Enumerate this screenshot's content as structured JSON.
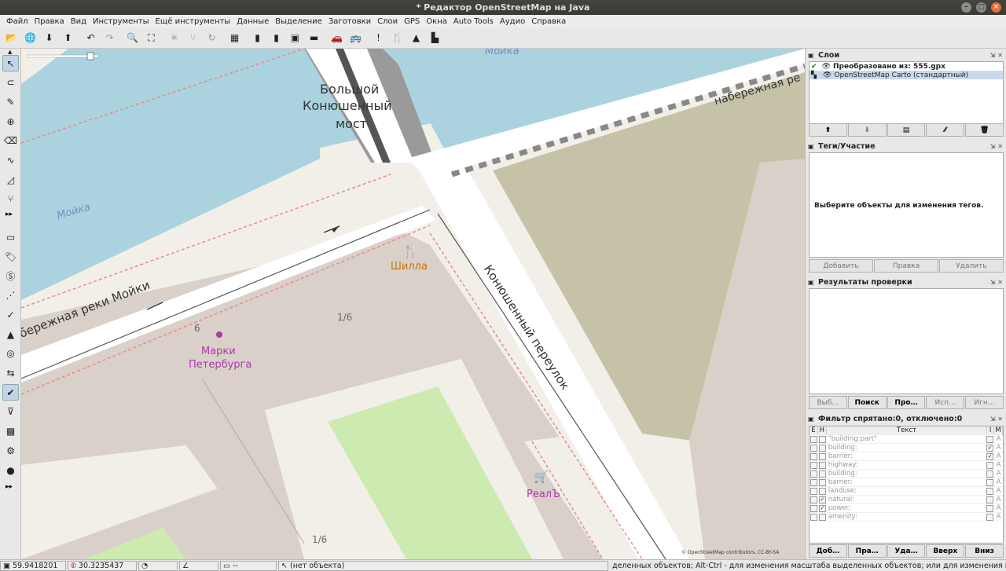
{
  "window": {
    "title": "* Редактор OpenStreetMap на Java",
    "buttons": [
      "–",
      "□",
      "×"
    ]
  },
  "menu": [
    "Файл",
    "Правка",
    "Вид",
    "Инструменты",
    "Ещё инструменты",
    "Данные",
    "Выделение",
    "Заготовки",
    "Слои",
    "GPS",
    "Окна",
    "Auto Tools",
    "Аудио",
    "Справка"
  ],
  "toolbar": [
    {
      "glyph": "📂",
      "name": "open-file-icon"
    },
    {
      "glyph": "🌐",
      "name": "open-location-icon"
    },
    {
      "glyph": "⬇",
      "name": "download-icon"
    },
    {
      "glyph": "⬆",
      "name": "upload-icon"
    },
    {
      "glyph": "↶",
      "name": "undo-icon"
    },
    {
      "glyph": "↷",
      "name": "redo-icon",
      "dim": true
    },
    {
      "glyph": "🔍",
      "name": "zoom-selection-icon"
    },
    {
      "glyph": "⛶",
      "name": "zoom-data-icon"
    },
    {
      "glyph": "✳",
      "name": "combine-way-icon",
      "dim": true
    },
    {
      "glyph": "⑂",
      "name": "split-way-icon",
      "dim": true
    },
    {
      "glyph": "↻",
      "name": "reverse-way-icon",
      "dim": true
    },
    {
      "glyph": "▦",
      "name": "imagery-icon"
    },
    {
      "glyph": "▮",
      "name": "road-preset-icon"
    },
    {
      "glyph": "▮",
      "name": "track-preset-icon"
    },
    {
      "glyph": "▣",
      "name": "traffic-light-preset-icon"
    },
    {
      "glyph": "▬",
      "name": "wall-preset-icon"
    },
    {
      "glyph": "🚗",
      "name": "car-preset-icon"
    },
    {
      "glyph": "🚌",
      "name": "bus-preset-icon"
    },
    {
      "glyph": "!",
      "name": "hazard-preset-icon"
    },
    {
      "glyph": "🍴",
      "name": "restaurant-preset-icon"
    },
    {
      "glyph": "▲",
      "name": "castle-preset-icon"
    },
    {
      "glyph": "▙",
      "name": "factory-preset-icon"
    }
  ],
  "left_tools": [
    {
      "glyph": "↖",
      "name": "select-tool-icon",
      "sel": true
    },
    {
      "glyph": "⊂",
      "name": "lasso-tool-icon"
    },
    {
      "glyph": "✎",
      "name": "draw-tool-icon"
    },
    {
      "glyph": "⊕",
      "name": "zoom-tool-icon"
    },
    {
      "glyph": "⌫",
      "name": "delete-tool-icon"
    },
    {
      "glyph": "∿",
      "name": "improve-way-tool-icon"
    },
    {
      "glyph": "◿",
      "name": "parallel-tool-icon"
    },
    {
      "glyph": "⑂",
      "name": "split-tool-icon"
    },
    {
      "glyph": "▭",
      "name": "layer-list-toggle-icon"
    },
    {
      "glyph": "🏷",
      "name": "tags-toggle-icon"
    },
    {
      "glyph": "Ⓢ",
      "name": "selection-list-toggle-icon"
    },
    {
      "glyph": "⋰",
      "name": "relation-toggle-icon"
    },
    {
      "glyph": "✓",
      "name": "commands-toggle-icon"
    },
    {
      "glyph": "▲",
      "name": "conflict-toggle-icon"
    },
    {
      "glyph": "◎",
      "name": "notes-toggle-icon"
    },
    {
      "glyph": "⇆",
      "name": "map-paint-toggle-icon"
    },
    {
      "glyph": "✔",
      "name": "validator-toggle-icon",
      "sel": true
    },
    {
      "glyph": "⊽",
      "name": "filter-toggle-icon"
    },
    {
      "glyph": "▩",
      "name": "changeset-toggle-icon"
    },
    {
      "glyph": "⚙",
      "name": "settings-toggle-icon"
    },
    {
      "glyph": "●",
      "name": "geotag-toggle-icon"
    }
  ],
  "more_glyph": "▸▸",
  "map": {
    "labels": [
      "Мойка",
      "Большой",
      "Конюшенный",
      "мост",
      "набережная ре",
      "Мойка",
      "Шилла",
      "Конюшенный переулок",
      "бережная реки Мойки",
      "6",
      "1/6",
      "Марки",
      "Петербурга",
      "РеалЪ",
      "1/6"
    ],
    "attribution": "© OpenStreetMap contributors, CC-BY-SA",
    "colors": {
      "water": "#aad3df",
      "land": "#f2efe9",
      "building": "#d9d0c9",
      "park": "#cdebb0",
      "wood": "#c6c2a8",
      "road": "#ffffff",
      "food": "#c77400",
      "shop": "#ac39ac"
    }
  },
  "panels": {
    "layers": {
      "title": "Слои",
      "items": [
        {
          "name": "Преобразовано из: 555.gpx",
          "sel": false
        },
        {
          "name": "OpenStreetMap Carto (стандартный)",
          "sel": true
        }
      ],
      "buttons": [
        "⬆",
        "⬇",
        "▤",
        "⁄⁄",
        "🗑"
      ]
    },
    "tags": {
      "title": "Теги/Участие",
      "empty": "Выберите объекты для изменения тегов.",
      "buttons": [
        "Добавить",
        "Правка",
        "Удалить"
      ]
    },
    "validation": {
      "title": "Результаты проверки",
      "buttons": [
        "Выб…",
        "Поиск",
        "Про…",
        "Исп…",
        "Игн…"
      ]
    },
    "filter": {
      "title": "Фильтр спрятано:0, отключено:0",
      "headers": [
        "E",
        "H",
        "Текст",
        "I",
        "M"
      ],
      "rows": [
        {
          "text": "\"building:part\"",
          "e": false,
          "h": false,
          "i": false,
          "m": "A"
        },
        {
          "text": "building:",
          "e": false,
          "h": false,
          "i": true,
          "m": "A"
        },
        {
          "text": "barrier:",
          "e": false,
          "h": false,
          "i": true,
          "m": "A"
        },
        {
          "text": "highway:",
          "e": false,
          "h": false,
          "i": false,
          "m": "A"
        },
        {
          "text": "building:",
          "e": false,
          "h": false,
          "i": false,
          "m": "A"
        },
        {
          "text": "barrier:",
          "e": false,
          "h": false,
          "i": false,
          "m": "A"
        },
        {
          "text": "landuse:",
          "e": false,
          "h": false,
          "i": false,
          "m": "A"
        },
        {
          "text": "natural:",
          "e": false,
          "h": true,
          "i": false,
          "m": "A"
        },
        {
          "text": "power:",
          "e": false,
          "h": true,
          "i": false,
          "m": "A"
        },
        {
          "text": "amenity:",
          "e": false,
          "h": false,
          "i": false,
          "m": "A"
        }
      ],
      "buttons": [
        "Доб…",
        "Пра…",
        "Уда…",
        "Вверх",
        "Вниз"
      ]
    }
  },
  "status": {
    "lat": "59.9418201",
    "lon": "30.3235437",
    "heading": "",
    "angle": "",
    "length": "--",
    "object": "(нет объекта)",
    "help": "деленных объектов; Alt-Ctrl - для изменения масштаба выделенных объектов; или для изменения выделения"
  }
}
